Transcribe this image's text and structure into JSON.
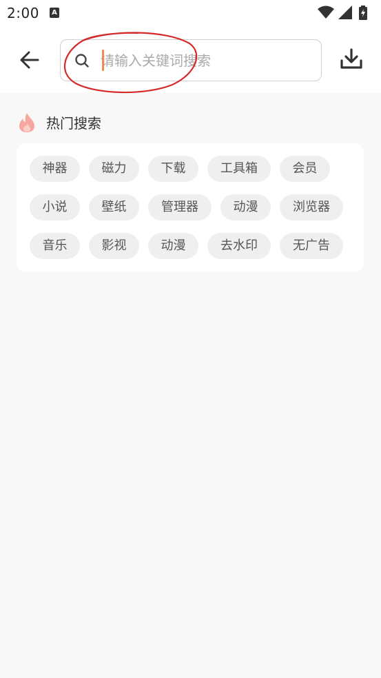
{
  "status_bar": {
    "time": "2:00",
    "notification_icon_letter": "A",
    "icons": [
      "wifi-icon",
      "signal-icon",
      "battery-charging-icon"
    ]
  },
  "header": {
    "back_icon": "arrow-left-icon",
    "search": {
      "icon": "search-icon",
      "placeholder": "请输入关键词搜索",
      "value": ""
    },
    "download_icon": "download-icon",
    "annotation_color": "#d42a2a"
  },
  "hot_search": {
    "icon": "fire-icon",
    "title": "热门搜索",
    "tags": [
      [
        "神器",
        "磁力",
        "下载",
        "工具箱",
        "会员"
      ],
      [
        "小说",
        "壁纸",
        "管理器",
        "动漫",
        "浏览器"
      ],
      [
        "音乐",
        "影视",
        "动漫",
        "去水印",
        "无广告"
      ]
    ]
  },
  "colors": {
    "accent": "#f08a55",
    "fire": "#f7a7a0",
    "tag_bg": "#efefef",
    "page_bg": "#f8f8f8"
  }
}
